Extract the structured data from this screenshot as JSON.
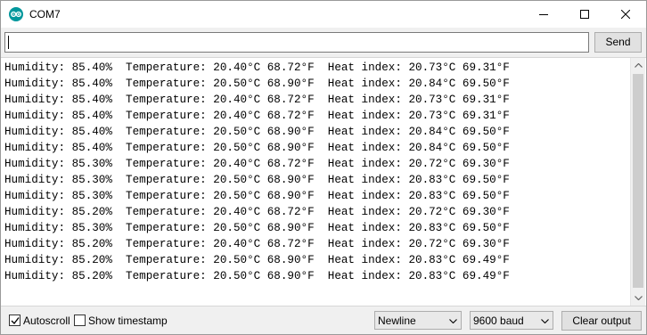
{
  "window": {
    "title": "COM7",
    "icon": "arduino-logo-icon",
    "controls": [
      "minimize-icon",
      "maximize-icon",
      "close-icon"
    ]
  },
  "input": {
    "value": "",
    "send_label": "Send"
  },
  "output": {
    "lines": [
      "Humidity: 85.40%  Temperature: 20.40°C 68.72°F  Heat index: 20.73°C 69.31°F",
      "Humidity: 85.40%  Temperature: 20.50°C 68.90°F  Heat index: 20.84°C 69.50°F",
      "Humidity: 85.40%  Temperature: 20.40°C 68.72°F  Heat index: 20.73°C 69.31°F",
      "Humidity: 85.40%  Temperature: 20.40°C 68.72°F  Heat index: 20.73°C 69.31°F",
      "Humidity: 85.40%  Temperature: 20.50°C 68.90°F  Heat index: 20.84°C 69.50°F",
      "Humidity: 85.40%  Temperature: 20.50°C 68.90°F  Heat index: 20.84°C 69.50°F",
      "Humidity: 85.30%  Temperature: 20.40°C 68.72°F  Heat index: 20.72°C 69.30°F",
      "Humidity: 85.30%  Temperature: 20.50°C 68.90°F  Heat index: 20.83°C 69.50°F",
      "Humidity: 85.30%  Temperature: 20.50°C 68.90°F  Heat index: 20.83°C 69.50°F",
      "Humidity: 85.20%  Temperature: 20.40°C 68.72°F  Heat index: 20.72°C 69.30°F",
      "Humidity: 85.30%  Temperature: 20.50°C 68.90°F  Heat index: 20.83°C 69.50°F",
      "Humidity: 85.20%  Temperature: 20.40°C 68.72°F  Heat index: 20.72°C 69.30°F",
      "Humidity: 85.20%  Temperature: 20.50°C 68.90°F  Heat index: 20.83°C 69.49°F",
      "Humidity: 85.20%  Temperature: 20.50°C 68.90°F  Heat index: 20.83°C 69.49°F"
    ]
  },
  "footer": {
    "autoscroll_label": "Autoscroll",
    "autoscroll_checked": true,
    "timestamp_label": "Show timestamp",
    "timestamp_checked": false,
    "line_ending": "Newline",
    "baud_rate": "9600 baud",
    "clear_label": "Clear output"
  },
  "colors": {
    "accent": "#00979c",
    "background": "#f0f0f0",
    "console_background": "#ffffff"
  }
}
